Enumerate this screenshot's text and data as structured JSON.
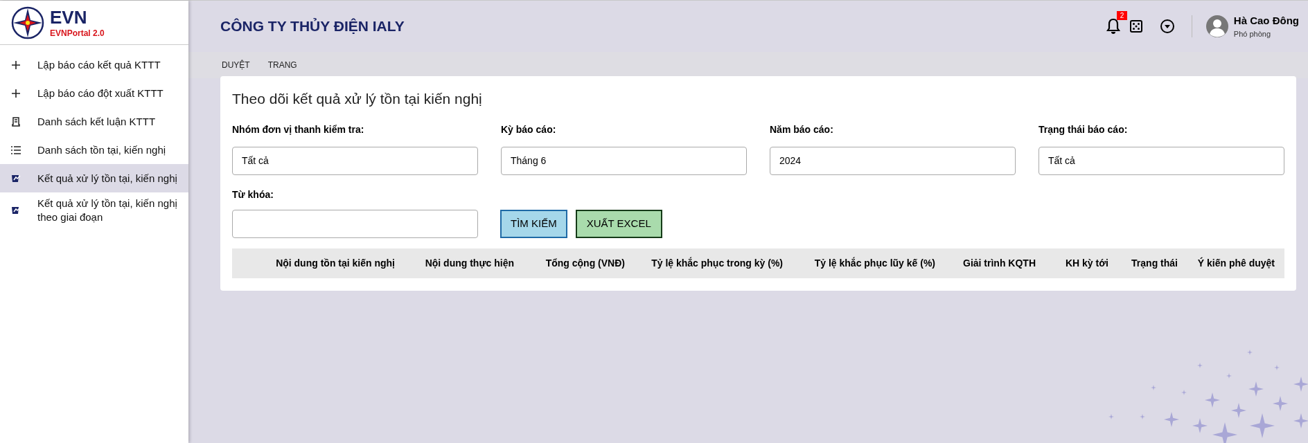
{
  "logo": {
    "brand": "EVN",
    "subtitle": "EVNPortal 2.0"
  },
  "sidebar": {
    "items": [
      {
        "label": "Lập báo cáo kết quả KTTT",
        "kind": "plus",
        "selected": false
      },
      {
        "label": "Lập báo cáo đột xuất KTTT",
        "kind": "plus",
        "selected": false
      },
      {
        "label": "Danh sách kết luận KTTT",
        "kind": "document",
        "selected": false
      },
      {
        "label": "Danh sách tồn tại, kiến nghị",
        "kind": "list",
        "selected": false
      },
      {
        "label": "Kết quả xử lý tồn tại, kiến nghị",
        "kind": "report",
        "selected": true
      },
      {
        "label": "Kết quả xử lý tồn tại, kiến nghị theo giai đoạn",
        "kind": "report",
        "selected": false
      }
    ]
  },
  "header": {
    "title": "CÔNG TY THỦY ĐIỆN IALY",
    "notification_count": "2",
    "user": {
      "name": "Hà Cao Đông",
      "role": "Phó phòng"
    }
  },
  "breadcrumb": [
    "DUYỆT",
    "TRANG"
  ],
  "card": {
    "title": "Theo dõi kết quả xử lý tồn tại kiến nghị",
    "filters": [
      {
        "label": "Nhóm đơn vị thanh kiểm tra:",
        "value": "Tất cả"
      },
      {
        "label": "Kỳ báo cáo:",
        "value": "Tháng 6"
      },
      {
        "label": "Năm báo cáo:",
        "value": "2024"
      },
      {
        "label": "Trạng thái báo cáo:",
        "value": "Tất cả"
      }
    ],
    "keyword": {
      "label": "Từ khóa:"
    },
    "buttons": [
      "TÌM KIẾM",
      "XUẤT EXCEL"
    ],
    "table": {
      "columns": [
        "Nội dung tồn tại kiến nghị",
        "Nội dung thực hiện",
        "Tổng cộng (VNĐ)",
        "Tỷ lệ khắc phục trong kỳ (%)",
        "Tỷ lệ khắc phục lũy kế (%)",
        "Giải trình KQTH",
        "KH kỳ tới",
        "Trạng thái",
        "Ý kiến phê duyệt"
      ]
    }
  }
}
